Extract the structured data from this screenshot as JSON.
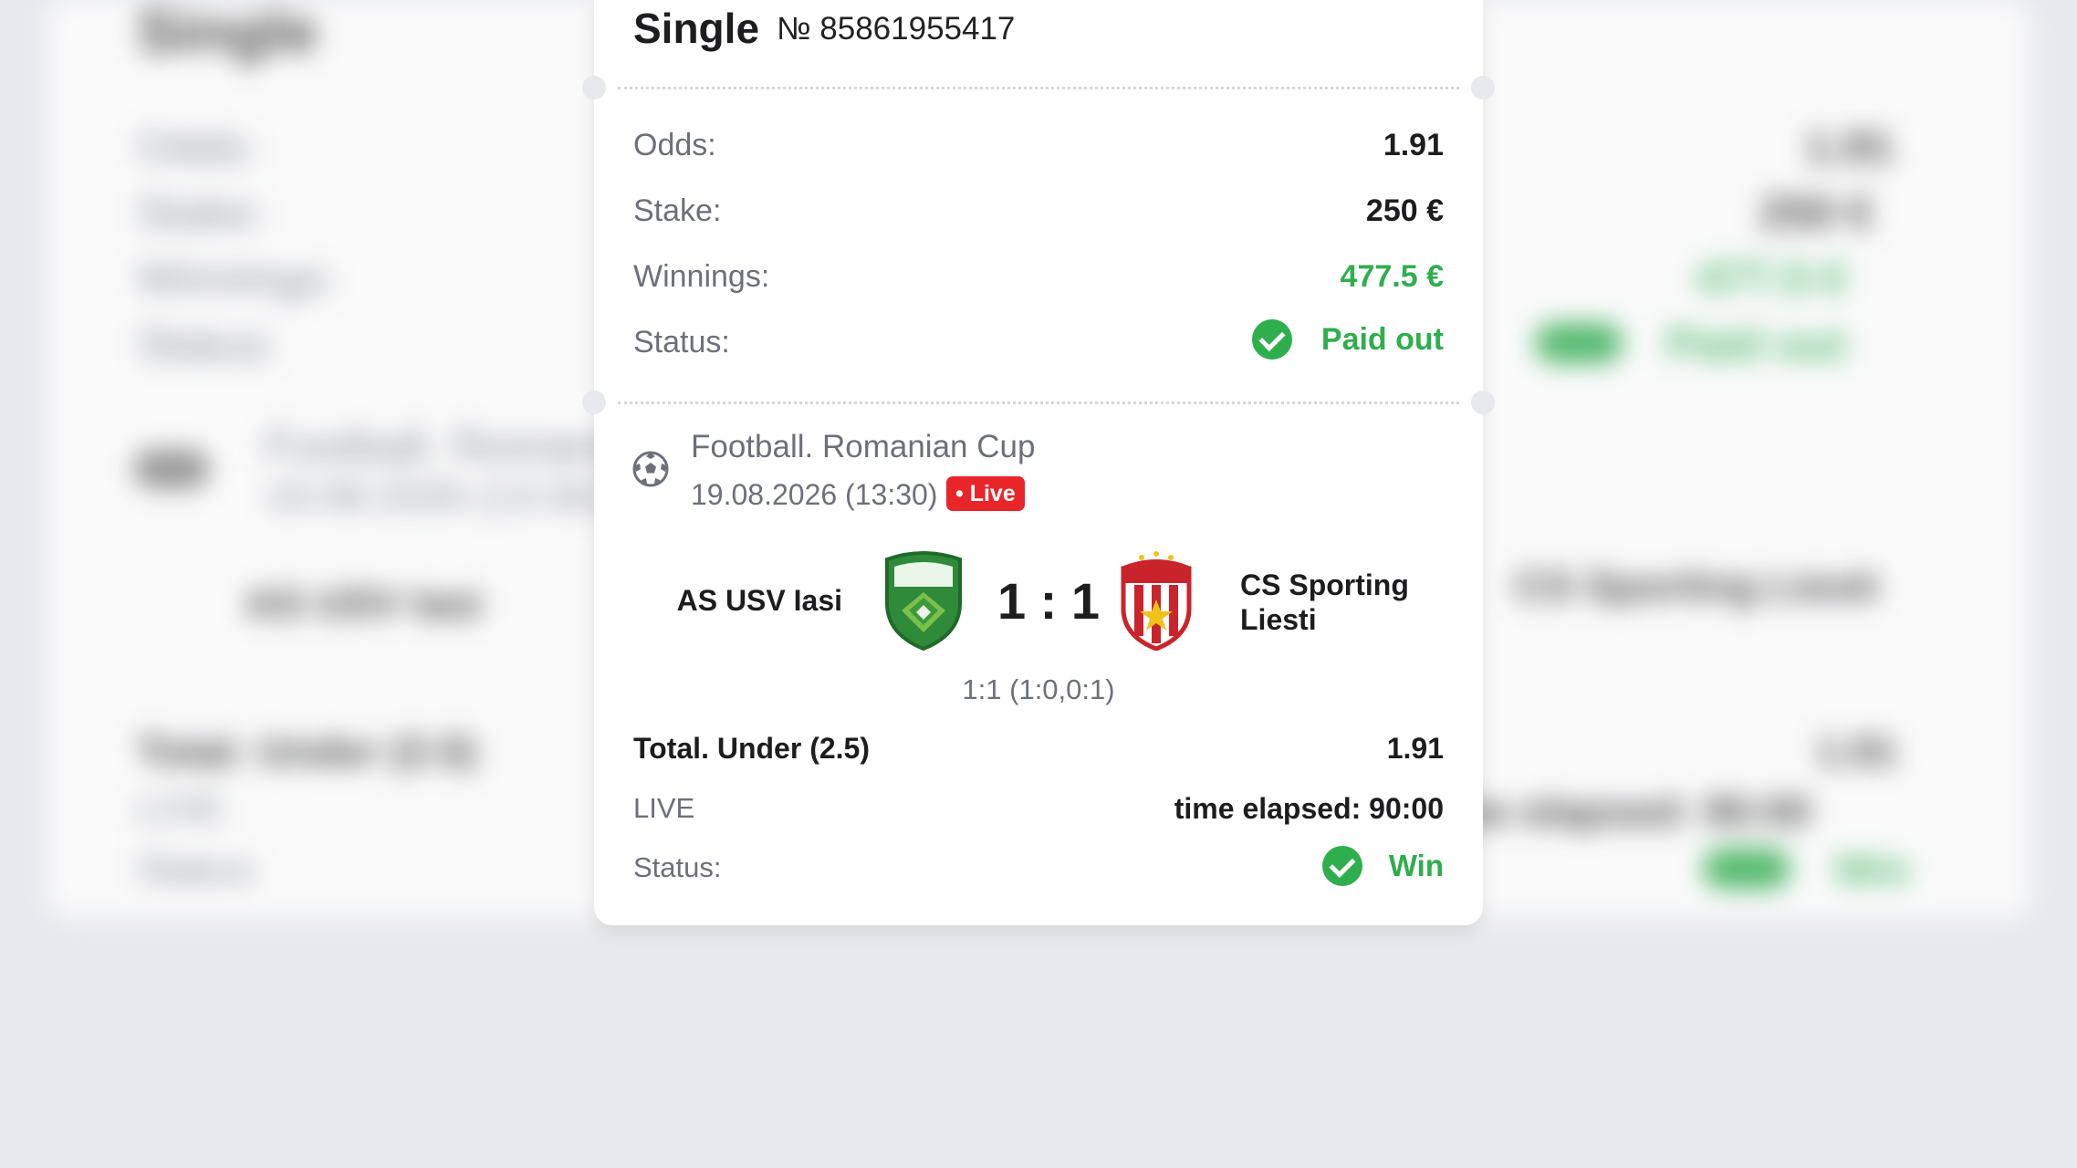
{
  "ticket": {
    "title": "Single",
    "number": "№ 85861955417"
  },
  "summary": {
    "odds_label": "Odds:",
    "odds_value": "1.91",
    "stake_label": "Stake:",
    "stake_value": "250 €",
    "winnings_label": "Winnings:",
    "winnings_value": "477.5 €",
    "status_label": "Status:",
    "status_value": "Paid out"
  },
  "event": {
    "league": "Football. Romanian Cup",
    "date": "19.08.2026 (13:30)",
    "live_badge": "• Live",
    "home_team": "AS USV Iasi",
    "away_team": "CS Sporting Liesti",
    "score": "1 : 1",
    "score_detail": "1:1 (1:0,0:1)"
  },
  "bet": {
    "name": "Total. Under (2.5)",
    "odds": "1.91",
    "mode": "LIVE",
    "elapsed": "time elapsed: 90:00",
    "status_label": "Status:",
    "status_value": "Win"
  },
  "colors": {
    "green": "#2fae4e",
    "live_red": "#e8262a",
    "background": "#e8e9ec"
  },
  "icons": [
    "football-icon",
    "check-circle-icon",
    "home-team-crest",
    "away-team-crest"
  ]
}
